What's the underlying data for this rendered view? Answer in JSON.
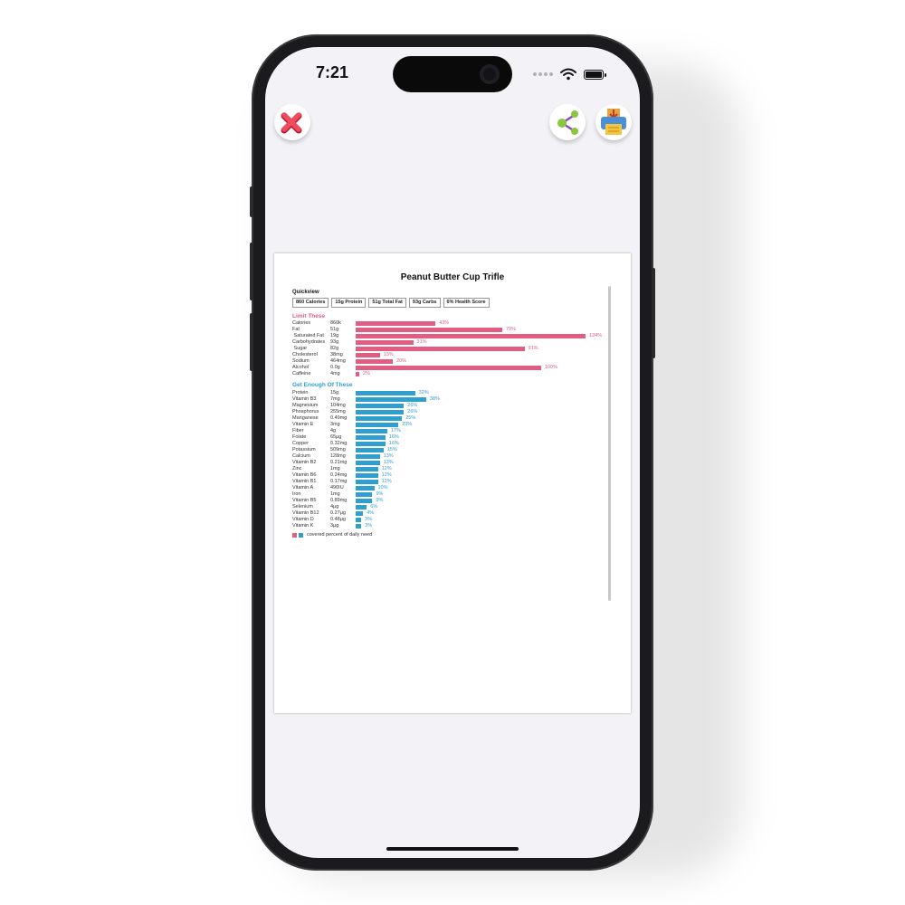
{
  "status_bar": {
    "time": "7:21"
  },
  "toolbar": {
    "close_icon": "close-x-icon",
    "share_icon": "share-icon",
    "print_icon": "printer-icon"
  },
  "document": {
    "title": "Peanut Butter Cup Trifle",
    "quickview_label": "Quickview",
    "quickview": [
      "860 Calories",
      "15g Protein",
      "51g Total Fat",
      "93g Carbs",
      "6% Health Score"
    ],
    "limit_title": "Limit These",
    "enough_title": "Get Enough Of These",
    "legend_label": "covered percent of daily need",
    "colors": {
      "limit": "#e35d82",
      "enough": "#2f9fcf"
    }
  },
  "chart_data": [
    {
      "type": "bar",
      "title": "Limit These",
      "categories": [
        "Calories",
        "Fat",
        "Saturated Fat",
        "Carbohydrates",
        "Sugar",
        "Cholesterol",
        "Sodium",
        "Alcohol",
        "Caffeine"
      ],
      "amounts": [
        "860k",
        "51g",
        "19g",
        "93g",
        "82g",
        "38mg",
        "464mg",
        "0.0g",
        "4mg"
      ],
      "labels": [
        "43%",
        "79%",
        "124%",
        "31%",
        "91%",
        "13%",
        "20%",
        "100%",
        "2%"
      ],
      "values": [
        43,
        79,
        124,
        31,
        91,
        13,
        20,
        100,
        2
      ]
    },
    {
      "type": "bar",
      "title": "Get Enough Of These",
      "categories": [
        "Protein",
        "Vitamin B3",
        "Magnesium",
        "Phosphorus",
        "Manganese",
        "Vitamin E",
        "Fiber",
        "Folate",
        "Copper",
        "Potassium",
        "Calcium",
        "Vitamin B2",
        "Zinc",
        "Vitamin B6",
        "Vitamin B1",
        "Vitamin A",
        "Iron",
        "Vitamin B5",
        "Selenium",
        "Vitamin B12",
        "Vitamin D",
        "Vitamin K"
      ],
      "amounts": [
        "15g",
        "7mg",
        "104mg",
        "255mg",
        "0.49mg",
        "3mg",
        "4g",
        "65µg",
        "0.32mg",
        "509mg",
        "128mg",
        "0.21mg",
        "1mg",
        "0.24mg",
        "0.17mg",
        "490IU",
        "1mg",
        "0.89mg",
        "4µg",
        "0.27µg",
        "0.48µg",
        "3µg"
      ],
      "labels": [
        "32%",
        "38%",
        "26%",
        "26%",
        "25%",
        "23%",
        "17%",
        "16%",
        "16%",
        "15%",
        "13%",
        "13%",
        "12%",
        "12%",
        "12%",
        "10%",
        "9%",
        "9%",
        "6%",
        "4%",
        "3%",
        "3%"
      ],
      "values": [
        32,
        38,
        26,
        26,
        25,
        23,
        17,
        16,
        16,
        15,
        13,
        13,
        12,
        12,
        12,
        10,
        9,
        9,
        6,
        4,
        3,
        3
      ]
    }
  ]
}
